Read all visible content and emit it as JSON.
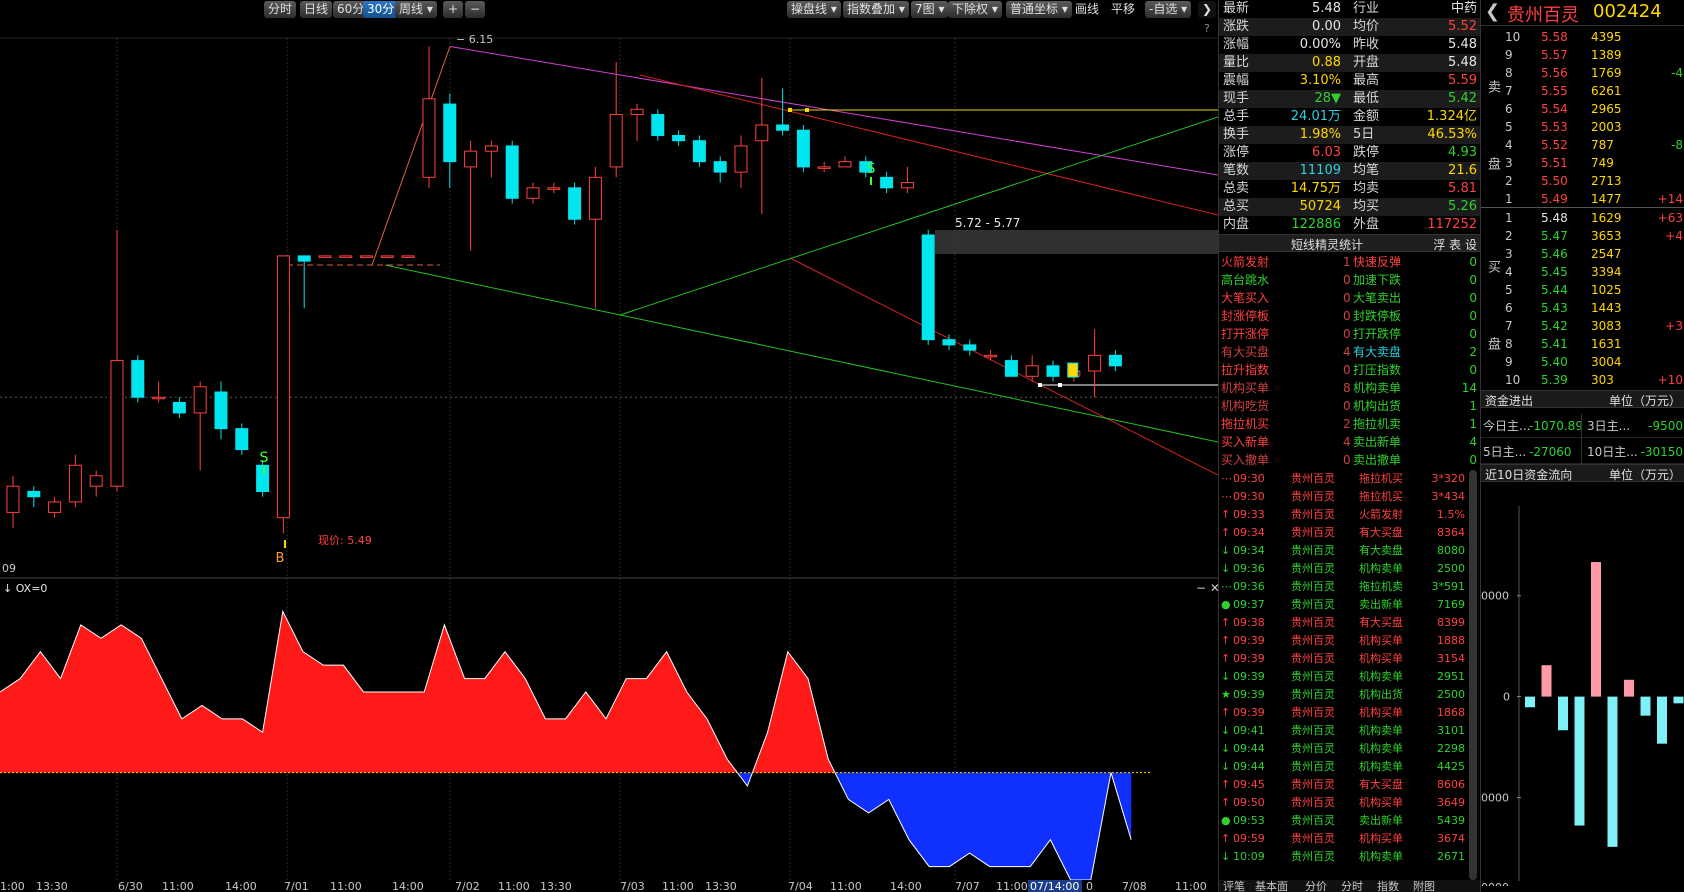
{
  "toolbar": {
    "periods": [
      "分时",
      "日线",
      "60分",
      "30分",
      "周线 ▾"
    ],
    "active_period": "30分",
    "zoom_in": "+",
    "zoom_out": "−",
    "right_buttons": [
      "操盘线 ▾",
      "指数叠加 ▾",
      "7图 ▾",
      "下除权 ▾",
      "普通坐标 ▾",
      "画线",
      "平移",
      "-自选 ▾"
    ],
    "help": "?",
    "collapse": "❯"
  },
  "chart": {
    "peak_label": "6.15",
    "range_label": "5.72 - 5.77",
    "current_price_label": "现价: 5.49",
    "buy_marker": "B",
    "sell_marker": "S",
    "left_edge_label": "09",
    "indicator_label": "↓ OX=0",
    "indicator_close": "−  ✕",
    "x_ticks": [
      "1:00",
      "13:30",
      "6/30",
      "11:00",
      "14:00",
      "7/01",
      "11:00",
      "14:00",
      "7/02",
      "11:00",
      "13:30",
      "7/03",
      "11:00",
      "13:30",
      "7/04",
      "11:00",
      "14:00",
      "7/07",
      "11:00",
      "07/14:00",
      "0",
      "7/08",
      "11:00"
    ],
    "x_highlight": "07/14:00"
  },
  "quote": {
    "rows": [
      {
        "l1": "最新",
        "v1": "5.48",
        "c1": "white",
        "l2": "行业",
        "v2": "中药",
        "c2": "white"
      },
      {
        "l1": "涨跌",
        "v1": "0.00",
        "c1": "white",
        "l2": "均价",
        "v2": "5.52",
        "c2": "red"
      },
      {
        "l1": "涨幅",
        "v1": "0.00%",
        "c1": "white",
        "l2": "昨收",
        "v2": "5.48",
        "c2": "white"
      },
      {
        "l1": "量比",
        "v1": "0.88",
        "c1": "yellow",
        "l2": "开盘",
        "v2": "5.48",
        "c2": "white"
      },
      {
        "l1": "震幅",
        "v1": "3.10%",
        "c1": "yellow",
        "l2": "最高",
        "v2": "5.59",
        "c2": "red"
      },
      {
        "l1": "现手",
        "v1": "28▼",
        "c1": "green",
        "l2": "最低",
        "v2": "5.42",
        "c2": "green"
      },
      {
        "l1": "总手",
        "v1": "24.01万",
        "c1": "cyan",
        "l2": "金额",
        "v2": "1.324亿",
        "c2": "yellow"
      },
      {
        "l1": "换手",
        "v1": "1.98%",
        "c1": "yellow",
        "l2": "5日",
        "v2": "46.53%",
        "c2": "yellow"
      },
      {
        "l1": "涨停",
        "v1": "6.03",
        "c1": "red",
        "l2": "跌停",
        "v2": "4.93",
        "c2": "green"
      },
      {
        "l1": "笔数",
        "v1": "11109",
        "c1": "cyan",
        "l2": "均笔",
        "v2": "21.6",
        "c2": "yellow"
      },
      {
        "l1": "总卖",
        "v1": "14.75万",
        "c1": "yellow",
        "l2": "均卖",
        "v2": "5.81",
        "c2": "red"
      },
      {
        "l1": "总买",
        "v1": "50724",
        "c1": "yellow",
        "l2": "均买",
        "v2": "5.26",
        "c2": "green"
      },
      {
        "l1": "内盘",
        "v1": "122886",
        "c1": "green",
        "l2": "外盘",
        "v2": "117252",
        "c2": "red"
      }
    ],
    "stats_title": "短线精灵统计",
    "stats_buttons": "浮 表 设",
    "stats": [
      {
        "a": "火箭发射",
        "av": "1",
        "b": "快速反弹",
        "bv": "0"
      },
      {
        "a": "高台跳水",
        "av": "0",
        "b": "加速下跌",
        "bv": "0"
      },
      {
        "a": "大笔买入",
        "av": "0",
        "b": "大笔卖出",
        "bv": "0"
      },
      {
        "a": "封涨停板",
        "av": "0",
        "b": "封跌停板",
        "bv": "0"
      },
      {
        "a": "打开涨停",
        "av": "0",
        "b": "打开跌停",
        "bv": "0"
      },
      {
        "a": "有大买盘",
        "av": "4",
        "b": "有大卖盘",
        "bv": "2"
      },
      {
        "a": "拉升指数",
        "av": "0",
        "b": "打压指数",
        "bv": "0"
      },
      {
        "a": "机构买单",
        "av": "8",
        "b": "机构卖单",
        "bv": "14"
      },
      {
        "a": "机构吃货",
        "av": "0",
        "b": "机构出货",
        "bv": "1"
      },
      {
        "a": "拖拉机买",
        "av": "2",
        "b": "拖拉机卖",
        "bv": "1"
      },
      {
        "a": "买入新单",
        "av": "4",
        "b": "卖出新单",
        "bv": "4"
      },
      {
        "a": "买入撤单",
        "av": "0",
        "b": "卖出撤单",
        "bv": "0"
      }
    ],
    "events": [
      {
        "mark": "⋯",
        "time": "09:30",
        "name": "贵州百灵",
        "type": "拖拉机买",
        "vol": "3*320",
        "color": "red"
      },
      {
        "mark": "⋯",
        "time": "09:30",
        "name": "贵州百灵",
        "type": "拖拉机买",
        "vol": "3*434",
        "color": "red"
      },
      {
        "mark": "↑",
        "time": "09:33",
        "name": "贵州百灵",
        "type": "火箭发射",
        "vol": "1.5%",
        "color": "red"
      },
      {
        "mark": "↑",
        "time": "09:34",
        "name": "贵州百灵",
        "type": "有大买盘",
        "vol": "8364",
        "color": "red"
      },
      {
        "mark": "↓",
        "time": "09:34",
        "name": "贵州百灵",
        "type": "有大卖盘",
        "vol": "8080",
        "color": "green"
      },
      {
        "mark": "↓",
        "time": "09:36",
        "name": "贵州百灵",
        "type": "机构卖单",
        "vol": "2500",
        "color": "green"
      },
      {
        "mark": "⋯",
        "time": "09:36",
        "name": "贵州百灵",
        "type": "拖拉机卖",
        "vol": "3*591",
        "color": "green"
      },
      {
        "mark": "●",
        "time": "09:37",
        "name": "贵州百灵",
        "type": "卖出新单",
        "vol": "7169",
        "color": "green"
      },
      {
        "mark": "↑",
        "time": "09:38",
        "name": "贵州百灵",
        "type": "有大买盘",
        "vol": "8399",
        "color": "red"
      },
      {
        "mark": "↑",
        "time": "09:39",
        "name": "贵州百灵",
        "type": "机构买单",
        "vol": "1888",
        "color": "red"
      },
      {
        "mark": "↑",
        "time": "09:39",
        "name": "贵州百灵",
        "type": "机构买单",
        "vol": "3154",
        "color": "red"
      },
      {
        "mark": "↓",
        "time": "09:39",
        "name": "贵州百灵",
        "type": "机构卖单",
        "vol": "2951",
        "color": "green"
      },
      {
        "mark": "★",
        "time": "09:39",
        "name": "贵州百灵",
        "type": "机构出货",
        "vol": "2500",
        "color": "green"
      },
      {
        "mark": "↑",
        "time": "09:39",
        "name": "贵州百灵",
        "type": "机构买单",
        "vol": "1868",
        "color": "red"
      },
      {
        "mark": "↓",
        "time": "09:41",
        "name": "贵州百灵",
        "type": "机构卖单",
        "vol": "3101",
        "color": "green"
      },
      {
        "mark": "↓",
        "time": "09:44",
        "name": "贵州百灵",
        "type": "机构卖单",
        "vol": "2298",
        "color": "green"
      },
      {
        "mark": "↓",
        "time": "09:44",
        "name": "贵州百灵",
        "type": "机构卖单",
        "vol": "4425",
        "color": "green"
      },
      {
        "mark": "↑",
        "time": "09:45",
        "name": "贵州百灵",
        "type": "有大买盘",
        "vol": "8606",
        "color": "red"
      },
      {
        "mark": "↑",
        "time": "09:50",
        "name": "贵州百灵",
        "type": "机构买单",
        "vol": "3649",
        "color": "red"
      },
      {
        "mark": "●",
        "time": "09:53",
        "name": "贵州百灵",
        "type": "卖出新单",
        "vol": "5439",
        "color": "green"
      },
      {
        "mark": "↑",
        "time": "09:59",
        "name": "贵州百灵",
        "type": "机构买单",
        "vol": "3674",
        "color": "red"
      },
      {
        "mark": "↓",
        "time": "10:09",
        "name": "贵州百灵",
        "type": "机构卖单",
        "vol": "2671",
        "color": "green"
      }
    ],
    "bottom_tabs": [
      "评笔",
      "基本面",
      "分价",
      "分时",
      "指数",
      "附图"
    ]
  },
  "orderbook": {
    "back": "❮",
    "name": "贵州百灵",
    "code": "002424",
    "sell_label": "卖 盘",
    "buy_label": "买 盘",
    "sells": [
      {
        "lvl": "10",
        "price": "5.58",
        "vol": "4395",
        "chg": ""
      },
      {
        "lvl": "9",
        "price": "5.57",
        "vol": "1389",
        "chg": ""
      },
      {
        "lvl": "8",
        "price": "5.56",
        "vol": "1769",
        "chg": "-4"
      },
      {
        "lvl": "7",
        "price": "5.55",
        "vol": "6261",
        "chg": ""
      },
      {
        "lvl": "6",
        "price": "5.54",
        "vol": "2965",
        "chg": ""
      },
      {
        "lvl": "5",
        "price": "5.53",
        "vol": "2003",
        "chg": ""
      },
      {
        "lvl": "4",
        "price": "5.52",
        "vol": "787",
        "chg": "-8"
      },
      {
        "lvl": "3",
        "price": "5.51",
        "vol": "749",
        "chg": ""
      },
      {
        "lvl": "2",
        "price": "5.50",
        "vol": "2713",
        "chg": ""
      },
      {
        "lvl": "1",
        "price": "5.49",
        "vol": "1477",
        "chg": "+14"
      }
    ],
    "buys": [
      {
        "lvl": "1",
        "price": "5.48",
        "vol": "1629",
        "chg": "+63"
      },
      {
        "lvl": "2",
        "price": "5.47",
        "vol": "3653",
        "chg": "+4"
      },
      {
        "lvl": "3",
        "price": "5.46",
        "vol": "2547",
        "chg": ""
      },
      {
        "lvl": "4",
        "price": "5.45",
        "vol": "3394",
        "chg": ""
      },
      {
        "lvl": "5",
        "price": "5.44",
        "vol": "1025",
        "chg": ""
      },
      {
        "lvl": "6",
        "price": "5.43",
        "vol": "1443",
        "chg": ""
      },
      {
        "lvl": "7",
        "price": "5.42",
        "vol": "3083",
        "chg": "+3"
      },
      {
        "lvl": "8",
        "price": "5.41",
        "vol": "1631",
        "chg": ""
      },
      {
        "lvl": "9",
        "price": "5.40",
        "vol": "3004",
        "chg": ""
      },
      {
        "lvl": "10",
        "price": "5.39",
        "vol": "303",
        "chg": "+10"
      }
    ],
    "flow_title": "资金进出",
    "flow_unit": "单位（万元）",
    "flow": [
      {
        "k": "今日主...",
        "v": "-1070.89",
        "k2": "3日主...",
        "v2": "-9500"
      },
      {
        "k": "5日主...",
        "v": "-27060",
        "k2": "10日主...",
        "v2": "-30150"
      }
    ],
    "flow10_title": "近10日资金流向",
    "flow10_unit": "单位（万元）",
    "flow10_axis": [
      "0000",
      "0",
      "0000",
      "0000"
    ]
  },
  "chart_data": [
    {
      "type": "candlestick",
      "title": "",
      "candles": [
        {
          "o": 5.26,
          "c": 5.31,
          "h": 5.33,
          "l": 5.23
        },
        {
          "o": 5.3,
          "c": 5.29,
          "h": 5.31,
          "l": 5.27
        },
        {
          "o": 5.26,
          "c": 5.28,
          "h": 5.29,
          "l": 5.25
        },
        {
          "o": 5.28,
          "c": 5.35,
          "h": 5.37,
          "l": 5.27
        },
        {
          "o": 5.31,
          "c": 5.33,
          "h": 5.34,
          "l": 5.29
        },
        {
          "o": 5.31,
          "c": 5.55,
          "h": 5.8,
          "l": 5.3
        },
        {
          "o": 5.55,
          "c": 5.48,
          "h": 5.56,
          "l": 5.47
        },
        {
          "o": 5.48,
          "c": 5.48,
          "h": 5.51,
          "l": 5.47
        },
        {
          "o": 5.47,
          "c": 5.45,
          "h": 5.48,
          "l": 5.44
        },
        {
          "o": 5.45,
          "c": 5.5,
          "h": 5.51,
          "l": 5.34
        },
        {
          "o": 5.49,
          "c": 5.42,
          "h": 5.51,
          "l": 5.4
        },
        {
          "o": 5.42,
          "c": 5.38,
          "h": 5.43,
          "l": 5.37
        },
        {
          "o": 5.35,
          "c": 5.3,
          "h": 5.36,
          "l": 5.29
        },
        {
          "o": 5.25,
          "c": 5.75,
          "h": 5.75,
          "l": 5.22
        },
        {
          "o": 5.75,
          "c": 5.74,
          "h": 5.75,
          "l": 5.65
        },
        {
          "o": 5.75,
          "c": 5.75,
          "h": 5.75,
          "l": 5.75
        },
        {
          "o": 5.75,
          "c": 5.75,
          "h": 5.75,
          "l": 5.75
        },
        {
          "o": 5.75,
          "c": 5.75,
          "h": 5.75,
          "l": 5.75
        },
        {
          "o": 5.75,
          "c": 5.75,
          "h": 5.75,
          "l": 5.75
        },
        {
          "o": 5.75,
          "c": 5.75,
          "h": 5.75,
          "l": 5.75
        },
        {
          "o": 5.9,
          "c": 6.05,
          "h": 6.15,
          "l": 5.88
        },
        {
          "o": 6.04,
          "c": 5.93,
          "h": 6.06,
          "l": 5.88
        },
        {
          "o": 5.92,
          "c": 5.95,
          "h": 5.97,
          "l": 5.76
        },
        {
          "o": 5.95,
          "c": 5.96,
          "h": 5.97,
          "l": 5.9
        },
        {
          "o": 5.96,
          "c": 5.86,
          "h": 5.97,
          "l": 5.85
        },
        {
          "o": 5.86,
          "c": 5.88,
          "h": 5.89,
          "l": 5.85
        },
        {
          "o": 5.88,
          "c": 5.88,
          "h": 5.89,
          "l": 5.87
        },
        {
          "o": 5.88,
          "c": 5.82,
          "h": 5.89,
          "l": 5.81
        },
        {
          "o": 5.82,
          "c": 5.9,
          "h": 5.92,
          "l": 5.65
        },
        {
          "o": 5.92,
          "c": 6.02,
          "h": 6.12,
          "l": 5.9
        },
        {
          "o": 6.02,
          "c": 6.03,
          "h": 6.04,
          "l": 5.97
        },
        {
          "o": 6.02,
          "c": 5.98,
          "h": 6.03,
          "l": 5.97
        },
        {
          "o": 5.98,
          "c": 5.97,
          "h": 5.99,
          "l": 5.96
        },
        {
          "o": 5.97,
          "c": 5.93,
          "h": 5.98,
          "l": 5.92
        },
        {
          "o": 5.93,
          "c": 5.91,
          "h": 5.94,
          "l": 5.89
        },
        {
          "o": 5.91,
          "c": 5.96,
          "h": 5.98,
          "l": 5.88
        },
        {
          "o": 5.97,
          "c": 6.0,
          "h": 6.09,
          "l": 5.83
        },
        {
          "o": 6.0,
          "c": 5.99,
          "h": 6.07,
          "l": 5.98
        },
        {
          "o": 5.99,
          "c": 5.92,
          "h": 6.0,
          "l": 5.91
        },
        {
          "o": 5.92,
          "c": 5.92,
          "h": 5.93,
          "l": 5.91
        },
        {
          "o": 5.92,
          "c": 5.93,
          "h": 5.94,
          "l": 5.92
        },
        {
          "o": 5.93,
          "c": 5.91,
          "h": 5.94,
          "l": 5.9
        },
        {
          "o": 5.9,
          "c": 5.88,
          "h": 5.91,
          "l": 5.87
        },
        {
          "o": 5.88,
          "c": 5.89,
          "h": 5.92,
          "l": 5.87
        },
        {
          "o": 5.79,
          "c": 5.59,
          "h": 5.8,
          "l": 5.58
        },
        {
          "o": 5.59,
          "c": 5.58,
          "h": 5.6,
          "l": 5.57
        },
        {
          "o": 5.58,
          "c": 5.57,
          "h": 5.59,
          "l": 5.56
        },
        {
          "o": 5.56,
          "c": 5.56,
          "h": 5.57,
          "l": 5.55
        },
        {
          "o": 5.55,
          "c": 5.52,
          "h": 5.56,
          "l": 5.52
        },
        {
          "o": 5.52,
          "c": 5.54,
          "h": 5.56,
          "l": 5.51
        },
        {
          "o": 5.54,
          "c": 5.52,
          "h": 5.55,
          "l": 5.51
        },
        {
          "o": 5.52,
          "c": 5.53,
          "h": 5.54,
          "l": 5.51
        },
        {
          "o": 5.53,
          "c": 5.56,
          "h": 5.61,
          "l": 5.48
        },
        {
          "o": 5.56,
          "c": 5.54,
          "h": 5.57,
          "l": 5.53
        }
      ],
      "ylim": [
        5.15,
        6.17
      ],
      "grid": false
    },
    {
      "type": "area",
      "title": "",
      "values": [
        6,
        7,
        9,
        7,
        11,
        10,
        11,
        10,
        7,
        4,
        5,
        4,
        4,
        3,
        12,
        9,
        8,
        8,
        6,
        6,
        6,
        6,
        11,
        7,
        7,
        9,
        7,
        4,
        4,
        6,
        4,
        7,
        7,
        9,
        6,
        4,
        1,
        -1,
        3,
        9,
        7,
        1,
        -2,
        -3,
        -2,
        -5,
        -7,
        -7,
        -6,
        -7,
        -7,
        -7,
        -5,
        -8,
        -8,
        0,
        -5
      ],
      "ylim": [
        -8,
        13
      ],
      "grid": false
    },
    {
      "type": "bar",
      "title": "",
      "values": [
        -9.5,
        28,
        -30,
        -115,
        120,
        -134,
        15,
        -17,
        -42,
        -6
      ],
      "ylim": [
        -160,
        170
      ],
      "grid": false
    }
  ]
}
